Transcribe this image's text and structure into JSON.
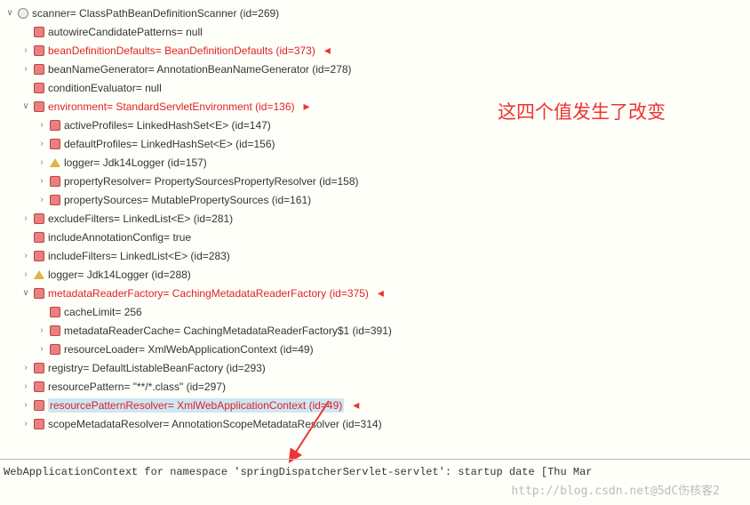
{
  "tree": {
    "root": "scanner= ClassPathBeanDefinitionScanner  (id=269)",
    "n1": "autowireCandidatePatterns= null",
    "n2": "beanDefinitionDefaults= BeanDefinitionDefaults  (id=373)",
    "n3": "beanNameGenerator= AnnotationBeanNameGenerator  (id=278)",
    "n4": "conditionEvaluator= null",
    "n5": "environment= StandardServletEnvironment  (id=136)",
    "n5a": "activeProfiles= LinkedHashSet<E>  (id=147)",
    "n5b": "defaultProfiles= LinkedHashSet<E>  (id=156)",
    "n5c": "logger= Jdk14Logger  (id=157)",
    "n5d": "propertyResolver= PropertySourcesPropertyResolver  (id=158)",
    "n5e": "propertySources= MutablePropertySources  (id=161)",
    "n6": "excludeFilters= LinkedList<E>  (id=281)",
    "n7": "includeAnnotationConfig= true",
    "n8": "includeFilters= LinkedList<E>  (id=283)",
    "n9": "logger= Jdk14Logger  (id=288)",
    "n10": "metadataReaderFactory= CachingMetadataReaderFactory  (id=375)",
    "n10a": "cacheLimit= 256",
    "n10b": "metadataReaderCache= CachingMetadataReaderFactory$1  (id=391)",
    "n10c": "resourceLoader= XmlWebApplicationContext  (id=49)",
    "n11": "registry= DefaultListableBeanFactory  (id=293)",
    "n12": "resourcePattern= \"**/*.class\"  (id=297)",
    "n13": "resourcePatternResolver= XmlWebApplicationContext  (id=49)",
    "n14": "scopeMetadataResolver= AnnotationScopeMetadataResolver  (id=314)"
  },
  "annotation": "这四个值发生了改变",
  "console": "WebApplicationContext for namespace 'springDispatcherServlet-servlet': startup date [Thu Mar",
  "watermark": "http://blog.csdn.net@5dC伤核客2"
}
